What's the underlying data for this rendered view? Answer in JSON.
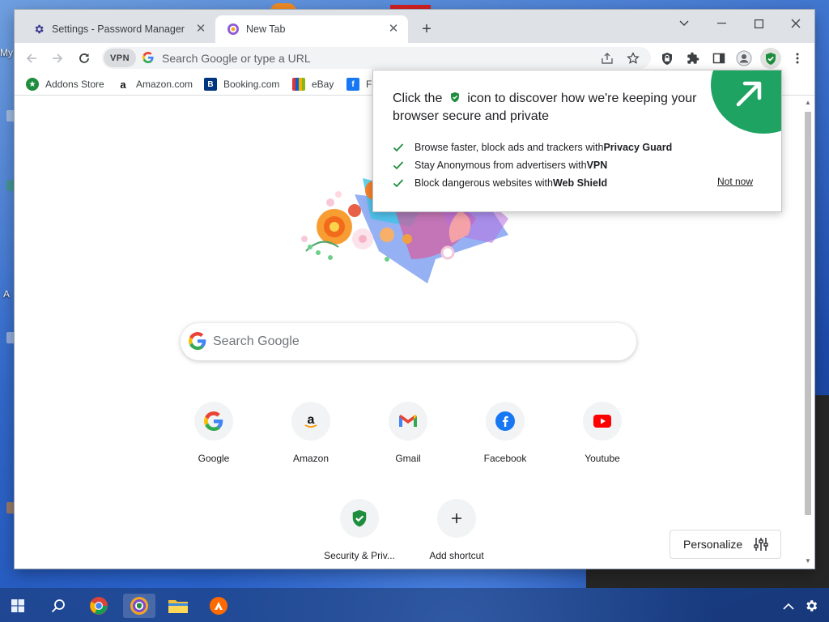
{
  "desktop": {
    "label": "My",
    "side_label": "A"
  },
  "tabs": [
    {
      "label": "Settings - Password Manager",
      "icon": "gear-icon",
      "active": false
    },
    {
      "label": "New Tab",
      "icon": "browser-logo-icon",
      "active": true
    }
  ],
  "omnibox": {
    "vpn_label": "VPN",
    "placeholder": "Search Google or type a URL"
  },
  "bookmarks": [
    {
      "label": "Addons Store",
      "icon": "addons-store-icon",
      "color": "#1e8e3e"
    },
    {
      "label": "Amazon.com",
      "icon": "amazon-icon",
      "color": "#ffffff"
    },
    {
      "label": "Booking.com",
      "icon": "booking-icon",
      "color": "#003580"
    },
    {
      "label": "eBay",
      "icon": "ebay-icon",
      "color": "#e53238"
    },
    {
      "label": "Fa",
      "icon": "facebook-icon",
      "color": "#1877f2"
    }
  ],
  "popup": {
    "title_before": "Click the",
    "title_after": "icon to discover how we're keeping your browser secure and private",
    "items": [
      {
        "text": "Browse faster, block ads and trackers with ",
        "bold": "Privacy Guard"
      },
      {
        "text": "Stay Anonymous from advertisers with ",
        "bold": "VPN"
      },
      {
        "text": "Block dangerous websites with ",
        "bold": "Web Shield"
      }
    ],
    "dismiss_label": "Not now",
    "accent_color": "#1ea362"
  },
  "search": {
    "placeholder": "Search Google"
  },
  "shortcuts": [
    {
      "label": "Google",
      "icon": "google-icon"
    },
    {
      "label": "Amazon",
      "icon": "amazon-icon"
    },
    {
      "label": "Gmail",
      "icon": "gmail-icon"
    },
    {
      "label": "Facebook",
      "icon": "facebook-icon"
    },
    {
      "label": "Youtube",
      "icon": "youtube-icon"
    },
    {
      "label": "Security & Priv...",
      "icon": "security-shield-icon"
    },
    {
      "label": "Add shortcut",
      "icon": "plus-icon"
    }
  ],
  "personalize": {
    "label": "Personalize"
  },
  "taskbar": {
    "items": [
      "windows-start-icon",
      "search-icon",
      "chrome-icon",
      "secure-browser-icon",
      "file-explorer-icon",
      "avast-icon"
    ]
  }
}
